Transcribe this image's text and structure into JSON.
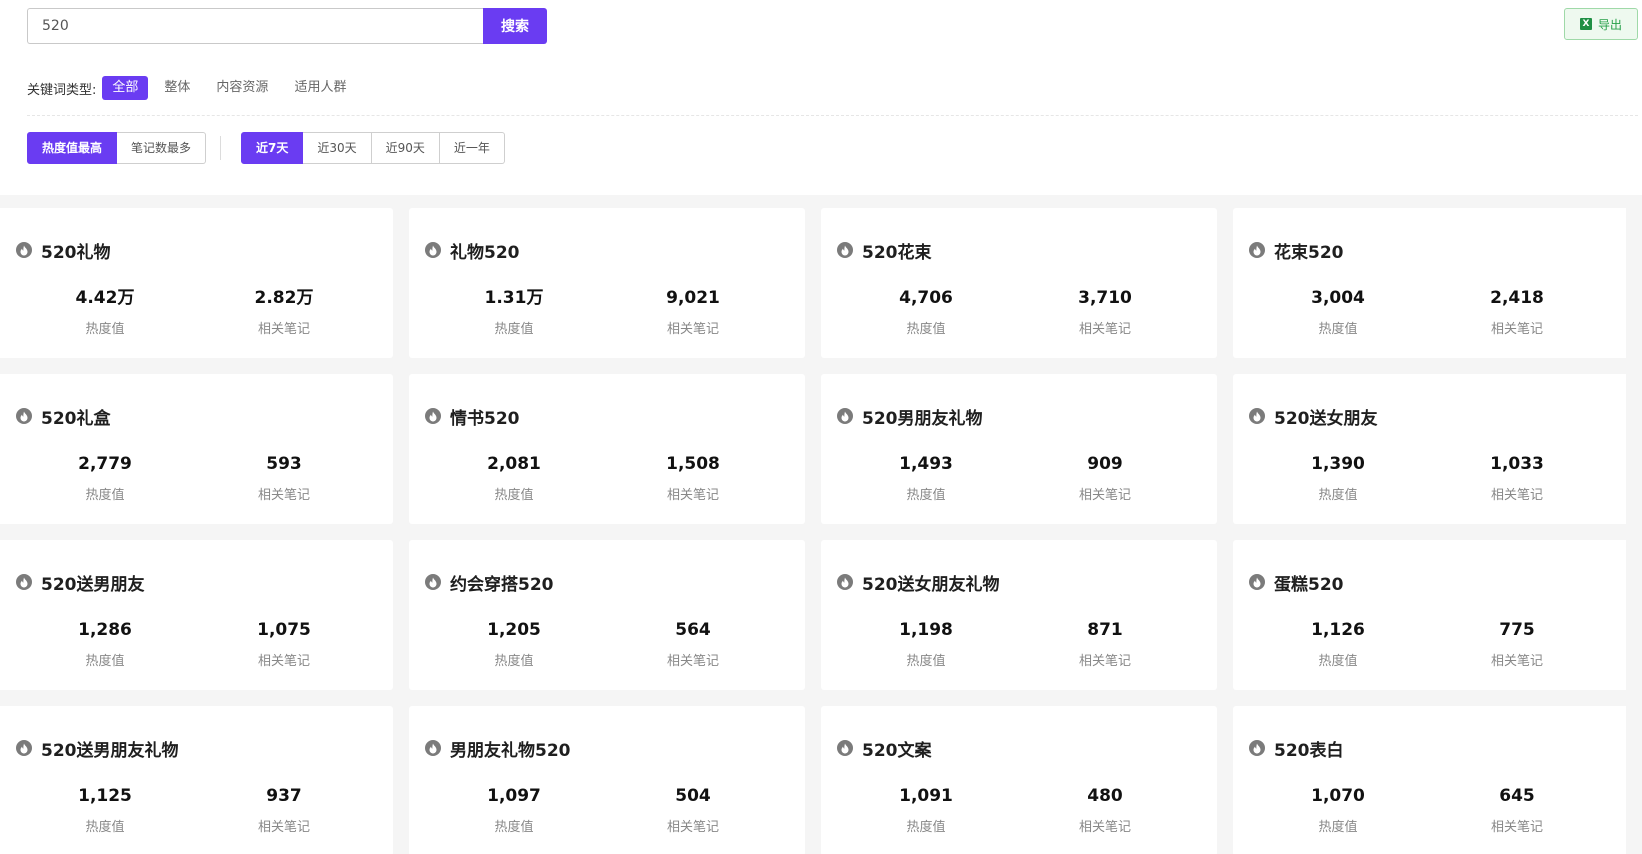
{
  "search": {
    "value": "520",
    "button_label": "搜索"
  },
  "export": {
    "label": "导出",
    "icon": "excel-icon"
  },
  "keyword_filter": {
    "label": "关键词类型:",
    "options": [
      "全部",
      "整体",
      "内容资源",
      "适用人群"
    ],
    "selected": "全部"
  },
  "sort_options": [
    "热度值最高",
    "笔记数最多"
  ],
  "sort_selected": "热度值最高",
  "period_options": [
    "近7天",
    "近30天",
    "近90天",
    "近一年"
  ],
  "period_selected": "近7天",
  "labels": {
    "hot": "热度值",
    "notes": "相关笔记"
  },
  "colors": {
    "accent": "#6a3cf2",
    "export_green": "#27a049"
  },
  "cards": [
    {
      "keyword": "520礼物",
      "hot": "4.42万",
      "notes": "2.82万"
    },
    {
      "keyword": "礼物520",
      "hot": "1.31万",
      "notes": "9,021"
    },
    {
      "keyword": "520花束",
      "hot": "4,706",
      "notes": "3,710"
    },
    {
      "keyword": "花束520",
      "hot": "3,004",
      "notes": "2,418"
    },
    {
      "keyword": "520礼盒",
      "hot": "2,779",
      "notes": "593"
    },
    {
      "keyword": "情书520",
      "hot": "2,081",
      "notes": "1,508"
    },
    {
      "keyword": "520男朋友礼物",
      "hot": "1,493",
      "notes": "909"
    },
    {
      "keyword": "520送女朋友",
      "hot": "1,390",
      "notes": "1,033"
    },
    {
      "keyword": "520送男朋友",
      "hot": "1,286",
      "notes": "1,075"
    },
    {
      "keyword": "约会穿搭520",
      "hot": "1,205",
      "notes": "564"
    },
    {
      "keyword": "520送女朋友礼物",
      "hot": "1,198",
      "notes": "871"
    },
    {
      "keyword": "蛋糕520",
      "hot": "1,126",
      "notes": "775"
    },
    {
      "keyword": "520送男朋友礼物",
      "hot": "1,125",
      "notes": "937"
    },
    {
      "keyword": "男朋友礼物520",
      "hot": "1,097",
      "notes": "504"
    },
    {
      "keyword": "520文案",
      "hot": "1,091",
      "notes": "480"
    },
    {
      "keyword": "520表白",
      "hot": "1,070",
      "notes": "645"
    }
  ]
}
